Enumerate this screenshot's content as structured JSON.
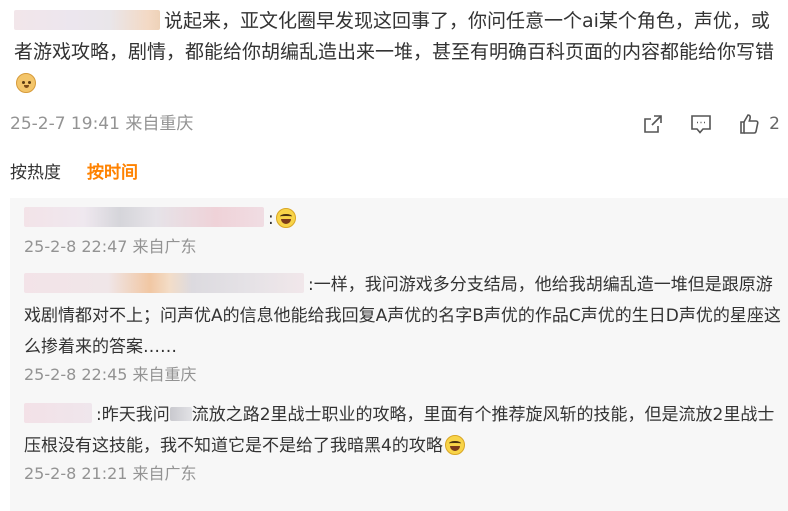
{
  "main_comment": {
    "text": "说起来，亚文化圈早发现这回事了，你问任意一个ai某个角色，声优，或者游戏攻略，剧情，都能给你胡编乱造出来一堆，甚至有明确百科页面的内容都能给你写错",
    "timestamp": "25-2-7 19:41 来自重庆",
    "like_count": "2"
  },
  "sort": {
    "hot_label": "按热度",
    "time_label": "按时间"
  },
  "replies": [
    {
      "text": ":",
      "timestamp": "25-2-8 22:47 来自广东"
    },
    {
      "text": ":一样，我问游戏多分支结局，他给我胡编乱造一堆但是跟原游戏剧情都对不上；问声优A的信息他能给我回复A声优的名字B声优的作品C声优的生日D声优的星座这么掺着来的答案……",
      "timestamp": "25-2-8 22:45 来自重庆"
    },
    {
      "text_before": ":昨天我问",
      "text_after": "流放之路2里战士职业的攻略，里面有个推荐旋风斩的技能，但是流放2里战士压根没有这技能，我不知道它是不是给了我暗黑4的攻略",
      "timestamp": "25-2-8 21:21 来自广东"
    }
  ],
  "icons": {
    "share": "share-icon",
    "comment": "comment-icon",
    "like": "thumbs-up-icon",
    "dog_emoji": "doge-emoji-icon",
    "laugh_emoji": "laugh-cry-emoji-icon"
  },
  "colors": {
    "accent": "#ff8200",
    "meta_text": "#939393",
    "reply_bg": "#f7f7f7"
  }
}
